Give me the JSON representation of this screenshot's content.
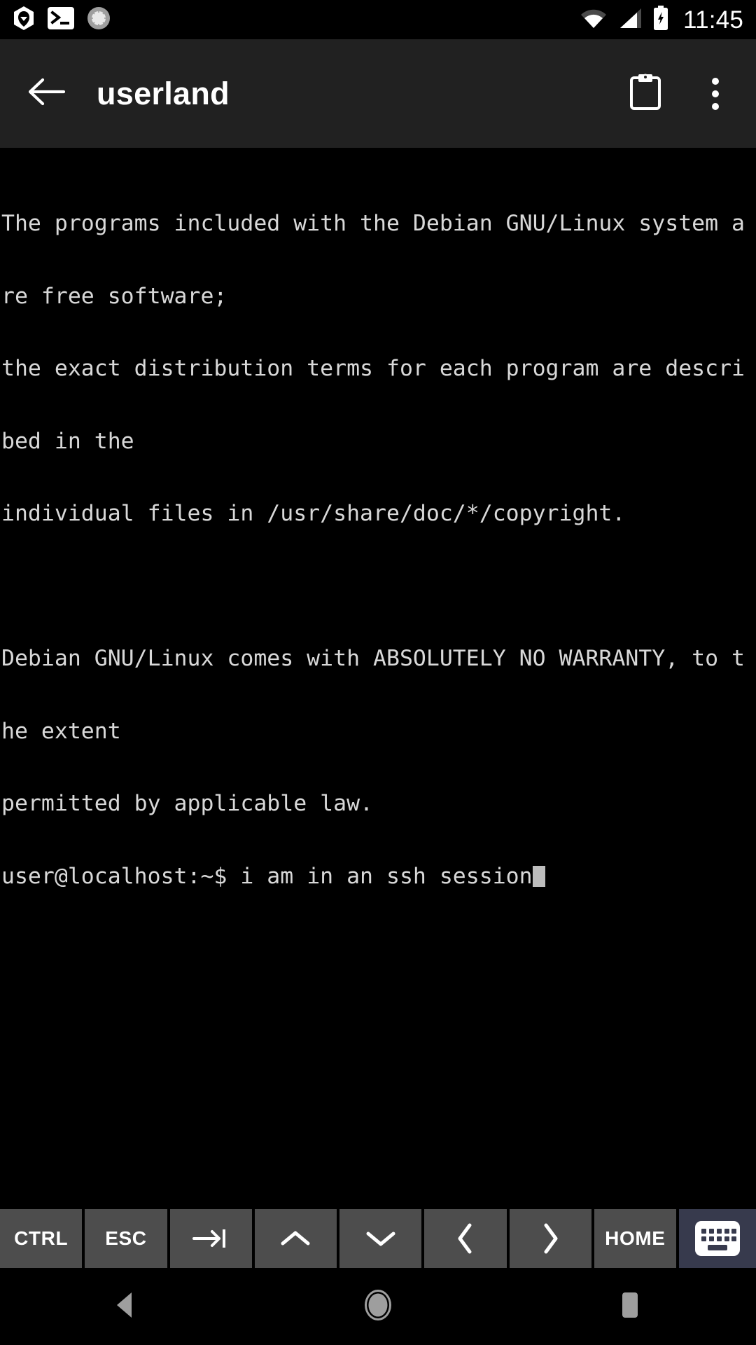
{
  "status_bar": {
    "icons": [
      {
        "name": "userland-app-icon",
        "label": "UserLAnd notification"
      },
      {
        "name": "terminal-icon",
        "label": "Terminal session notification"
      },
      {
        "name": "sync-progress-icon",
        "label": "Downloading / progress"
      }
    ],
    "wifi_icon": "wifi-icon",
    "signal_icon": "cellular-signal-icon",
    "battery_icon": "battery-charging-icon",
    "clock": "11:45"
  },
  "app_bar": {
    "back_icon": "back-arrow-icon",
    "title": "userland",
    "paste_icon": "clipboard-icon",
    "overflow_icon": "overflow-menu-icon"
  },
  "terminal": {
    "lines": [
      "The programs included with the Debian GNU/Linux system a",
      "re free software;",
      "the exact distribution terms for each program are descri",
      "bed in the",
      "individual files in /usr/share/doc/*/copyright.",
      "",
      "Debian GNU/Linux comes with ABSOLUTELY NO WARRANTY, to t",
      "he extent",
      "permitted by applicable law."
    ],
    "prompt": "user@localhost:~$ ",
    "command": "i am in an ssh session",
    "cursor": "block",
    "text_color": "#d8d8d8",
    "background_color": "#000000"
  },
  "key_toolbar": {
    "background": "#000000",
    "key_background": "#4d4d4d",
    "keyboard_key_background": "#373a4d",
    "keys": [
      {
        "name": "ctrl-key",
        "label": "CTRL",
        "type": "text"
      },
      {
        "name": "esc-key",
        "label": "ESC",
        "type": "text"
      },
      {
        "name": "tab-key",
        "label": "→|",
        "type": "icon",
        "icon": "tab-icon"
      },
      {
        "name": "up-key",
        "label": "∧",
        "type": "icon",
        "icon": "chevron-up-icon"
      },
      {
        "name": "down-key",
        "label": "∨",
        "type": "icon",
        "icon": "chevron-down-icon"
      },
      {
        "name": "left-key",
        "label": "‹",
        "type": "icon",
        "icon": "chevron-left-icon"
      },
      {
        "name": "right-key",
        "label": "›",
        "type": "icon",
        "icon": "chevron-right-icon"
      },
      {
        "name": "home-key",
        "label": "HOME",
        "type": "text"
      },
      {
        "name": "keyboard-key",
        "label": "",
        "type": "icon",
        "icon": "keyboard-icon"
      }
    ]
  },
  "nav_bar": {
    "back": "nav-back-icon",
    "home": "nav-home-icon",
    "recents": "nav-recents-icon"
  }
}
